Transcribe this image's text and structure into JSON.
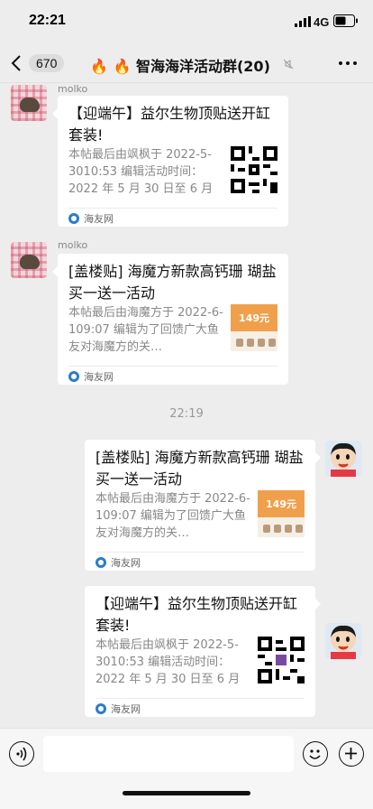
{
  "status_bar": {
    "time": "22:21",
    "network": "4G"
  },
  "nav": {
    "unread_count": "670",
    "title": "🔥 🔥 智海海洋活动群(20)"
  },
  "messages": [
    {
      "side": "left",
      "sender": "molko",
      "title": "【迎端午】益尔生物顶贴送开缸套装!",
      "desc": "本帖最后由飒枫于 2022-5-3010:53 编辑活动时间：2022 年 5 月 30 日至 6 月 …",
      "thumb": "qr",
      "source": "海友网"
    },
    {
      "side": "left",
      "sender": "molko",
      "title": "[盖楼贴] 海魔方新款高钙珊 瑚盐买一送一活动",
      "desc": "本帖最后由海魔方于 2022-6-109:07 编辑为了回馈广大鱼友对海魔方的关…",
      "thumb": "promo",
      "thumb_text": "149元",
      "source": "海友网"
    },
    {
      "side": "right",
      "title": "[盖楼贴] 海魔方新款高钙珊 瑚盐买一送一活动",
      "desc": "本帖最后由海魔方于 2022-6-109:07 编辑为了回馈广大鱼友对海魔方的关…",
      "thumb": "promo",
      "thumb_text": "149元",
      "source": "海友网"
    },
    {
      "side": "right",
      "title": "【迎端午】益尔生物顶贴送开缸套装!",
      "desc": "本帖最后由飒枫于 2022-5-3010:53 编辑活动时间：2022 年 5 月 30 日至 6 月 …",
      "thumb": "qr",
      "source": "海友网"
    }
  ],
  "timestamp": "22:19",
  "input": {
    "placeholder": ""
  },
  "colors": {
    "background": "#ededed",
    "card": "#ffffff",
    "source_icon": "#2a7dcc",
    "promo_orange": "#f0a04b"
  }
}
